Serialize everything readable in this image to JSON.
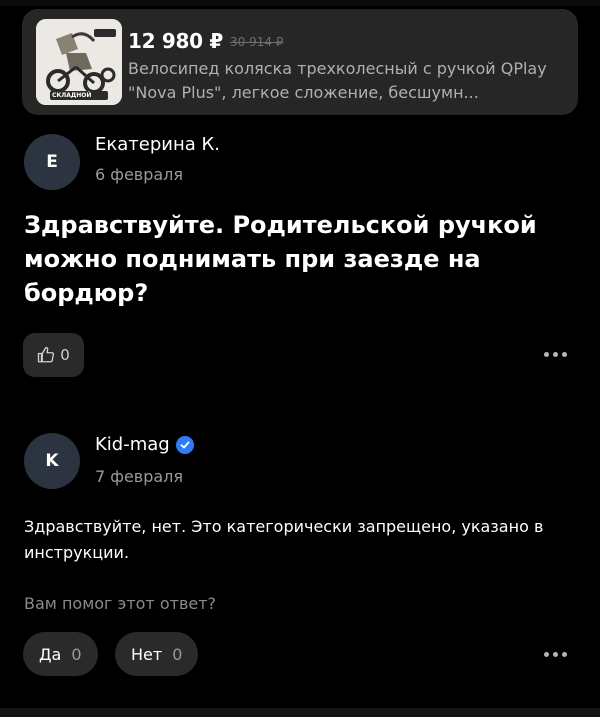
{
  "product": {
    "price": "12 980 ₽",
    "old_price": "30 914 ₽",
    "title": "Велосипед коляска трехколесный с ручкой QPlay \"Nova Plus\", легкое сложение, бесшумн...",
    "thumb_label": "СКЛАДНОЙ"
  },
  "question": {
    "avatar_letter": "Е",
    "author": "Екатерина К.",
    "date": "6 февраля",
    "text": "Здравствуйте. Родительской ручкой можно поднимать при заезде на бордюр?",
    "likes": "0"
  },
  "answer": {
    "avatar_letter": "K",
    "author": "Kid-mag",
    "date": "7 февраля",
    "text": "Здравствуйте, нет. Это категорически запрещено, указано в инструкции.",
    "helpful_question": "Вам помог этот ответ?",
    "yes_label": "Да",
    "yes_count": "0",
    "no_label": "Нет",
    "no_count": "0"
  },
  "colors": {
    "background": "#000000",
    "card": "#262626",
    "button": "#2a2a2a",
    "verified": "#2f7cf6",
    "muted_text": "#9a9a9a"
  },
  "icons": [
    "thumbs-up-icon",
    "more-dots-icon",
    "verified-check-icon"
  ]
}
